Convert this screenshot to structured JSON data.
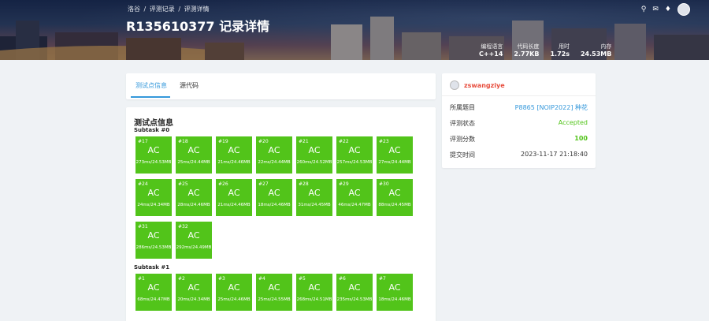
{
  "header": {
    "breadcrumbs": [
      "洛谷",
      "评测记录",
      "评测详情"
    ],
    "title": "R135610377 记录详情",
    "stats": [
      {
        "label": "编程语言",
        "value": "C++14"
      },
      {
        "label": "代码长度",
        "value": "2.77KB"
      },
      {
        "label": "用时",
        "value": "1.72s"
      },
      {
        "label": "内存",
        "value": "24.53MB"
      }
    ],
    "icons": [
      "search-icon",
      "mail-icon",
      "bell-icon"
    ]
  },
  "tabs": [
    "测试点信息",
    "源代码"
  ],
  "cases": {
    "title": "测试点信息",
    "subtasks": [
      {
        "name": "Subtask #0",
        "tests": [
          {
            "id": "#17",
            "status": "AC",
            "detail": "273ms/24.53MB"
          },
          {
            "id": "#18",
            "status": "AC",
            "detail": "25ms/24.44MB"
          },
          {
            "id": "#19",
            "status": "AC",
            "detail": "21ms/24.46MB"
          },
          {
            "id": "#20",
            "status": "AC",
            "detail": "22ms/24.44MB"
          },
          {
            "id": "#21",
            "status": "AC",
            "detail": "260ms/24.52MB"
          },
          {
            "id": "#22",
            "status": "AC",
            "detail": "257ms/24.53MB"
          },
          {
            "id": "#23",
            "status": "AC",
            "detail": "27ms/24.44MB"
          },
          {
            "id": "#24",
            "status": "AC",
            "detail": "24ms/24.34MB"
          },
          {
            "id": "#25",
            "status": "AC",
            "detail": "28ms/24.46MB"
          },
          {
            "id": "#26",
            "status": "AC",
            "detail": "21ms/24.46MB"
          },
          {
            "id": "#27",
            "status": "AC",
            "detail": "18ms/24.46MB"
          },
          {
            "id": "#28",
            "status": "AC",
            "detail": "31ms/24.45MB"
          },
          {
            "id": "#29",
            "status": "AC",
            "detail": "46ms/24.47MB"
          },
          {
            "id": "#30",
            "status": "AC",
            "detail": "88ms/24.45MB"
          },
          {
            "id": "#31",
            "status": "AC",
            "detail": "286ms/24.53MB"
          },
          {
            "id": "#32",
            "status": "AC",
            "detail": "292ms/24.49MB"
          }
        ]
      },
      {
        "name": "Subtask #1",
        "tests": [
          {
            "id": "#1",
            "status": "AC",
            "detail": "68ms/24.47MB"
          },
          {
            "id": "#2",
            "status": "AC",
            "detail": "20ms/24.34MB"
          },
          {
            "id": "#3",
            "status": "AC",
            "detail": "25ms/24.46MB"
          },
          {
            "id": "#4",
            "status": "AC",
            "detail": "25ms/24.55MB"
          },
          {
            "id": "#5",
            "status": "AC",
            "detail": "268ms/24.51MB"
          },
          {
            "id": "#6",
            "status": "AC",
            "detail": "235ms/24.53MB"
          },
          {
            "id": "#7",
            "status": "AC",
            "detail": "18ms/24.46MB"
          }
        ]
      }
    ]
  },
  "info": {
    "username": "zswangziye",
    "rows": [
      {
        "key": "所属题目",
        "value": "P8865 [NOIP2022] 种花",
        "style": "link"
      },
      {
        "key": "评测状态",
        "value": "Accepted",
        "style": "ok"
      },
      {
        "key": "评测分数",
        "value": "100",
        "style": "score"
      },
      {
        "key": "提交时间",
        "value": "2023-11-17 21:18:40",
        "style": "plain"
      }
    ]
  },
  "colors": {
    "accepted": "#52c41a",
    "accent": "#3498db",
    "username": "#e74c3c"
  }
}
